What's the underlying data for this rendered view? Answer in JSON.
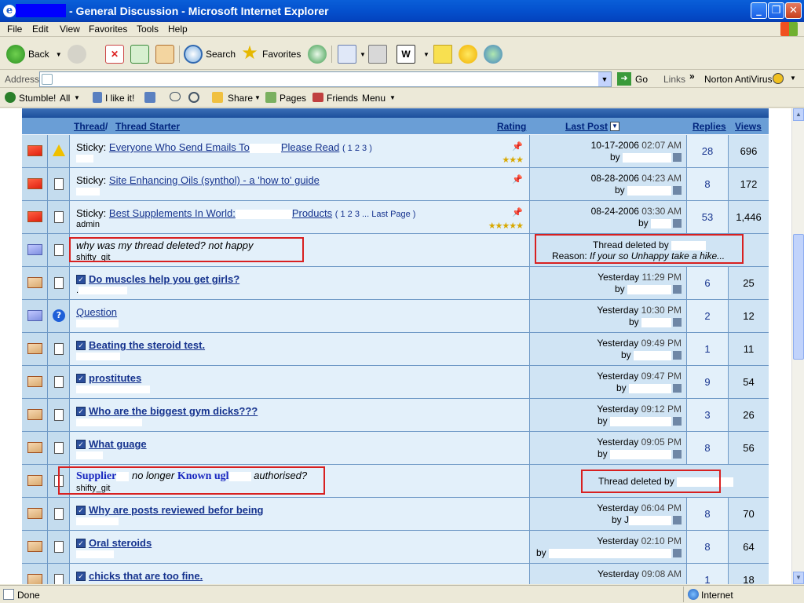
{
  "window": {
    "title": " - General Discussion - Microsoft Internet Explorer"
  },
  "menu": [
    "File",
    "Edit",
    "View",
    "Favorites",
    "Tools",
    "Help"
  ],
  "toolbar": {
    "back": "Back",
    "search": "Search",
    "favorites": "Favorites"
  },
  "address": {
    "label": "Address",
    "go": "Go",
    "links": "Links",
    "norton": "Norton AntiVirus"
  },
  "stumble": {
    "stumble": "Stumble!",
    "all": "All",
    "like": "I like it!",
    "share": "Share",
    "pages": "Pages",
    "friends": "Friends",
    "menu": "Menu"
  },
  "table": {
    "headers": {
      "thread": "Thread",
      "slash": " / ",
      "starter": "Thread Starter",
      "rating": "Rating",
      "lastpost": "Last Post",
      "replies": "Replies",
      "views": "Views"
    },
    "rows": [
      {
        "prefix": "Sticky: ",
        "title": "Everyone Who Send Emails To",
        "title2": "Please Read",
        "pages": "( 1 2 3 )",
        "sub": "",
        "date": "10-17-2006",
        "time": "02:07 AM",
        "by": "by",
        "replies": "28",
        "views": "696"
      },
      {
        "prefix": "Sticky: ",
        "title": "Site Enhancing Oils (synthol) - a 'how to' guide",
        "sub": "",
        "date": "08-28-2006",
        "time": "04:23 AM",
        "by": "by",
        "replies": "8",
        "views": "172"
      },
      {
        "prefix": "Sticky: ",
        "title": "Best Supplements In World:",
        "title2": "Products",
        "pages": "( 1 2 3 ... Last Page )",
        "sub": "admin",
        "date": "08-24-2006",
        "time": "03:30 AM",
        "by": "by",
        "replies": "53",
        "views": "1,446"
      },
      {
        "title": "why was my thread deleted? not happy",
        "sub": "shifty_git",
        "deleted_by": "Thread deleted by",
        "reason_label": "Reason:",
        "reason": "If your so Unhappy take a hike..."
      },
      {
        "title": "Do muscles help you get girls?",
        "sub": ".",
        "date": "Yesterday",
        "time": "11:29 PM",
        "by": "by",
        "replies": "6",
        "views": "25"
      },
      {
        "title": "Question",
        "sub": "",
        "date": "Yesterday",
        "time": "10:30 PM",
        "by": "by",
        "replies": "2",
        "views": "12"
      },
      {
        "title": "Beating the steroid test.",
        "sub": "",
        "date": "Yesterday",
        "time": "09:49 PM",
        "by": "by",
        "replies": "1",
        "views": "11"
      },
      {
        "title": "prostitutes",
        "sub": "",
        "date": "Yesterday",
        "time": "09:47 PM",
        "by": "by",
        "replies": "9",
        "views": "54"
      },
      {
        "title": "Who are the biggest gym dicks???",
        "sub": "",
        "date": "Yesterday",
        "time": "09:12 PM",
        "by": "by",
        "replies": "3",
        "views": "26"
      },
      {
        "title": "What guage",
        "sub": "",
        "date": "Yesterday",
        "time": "09:05 PM",
        "by": "by",
        "replies": "8",
        "views": "56"
      },
      {
        "overlay1": "Supplier",
        "mid": "no longer",
        "overlay2": "Known ugl",
        "end": "authorised?",
        "sub": "shifty_git",
        "deleted_by": "Thread deleted by"
      },
      {
        "title": "Why are posts reviewed befor being",
        "sub": "",
        "date": "Yesterday",
        "time": "06:04 PM",
        "by": "by J",
        "replies": "8",
        "views": "70"
      },
      {
        "title": "Oral steroids",
        "sub": "",
        "date": "Yesterday",
        "time": "02:10 PM",
        "by": "by",
        "replies": "8",
        "views": "64"
      },
      {
        "title": "chicks that are too fine.",
        "sub": "",
        "date": "Yesterday",
        "time": "09:08 AM",
        "by": "",
        "replies": "1",
        "views": "18"
      }
    ]
  },
  "status": {
    "done": "Done",
    "zone": "Internet"
  }
}
